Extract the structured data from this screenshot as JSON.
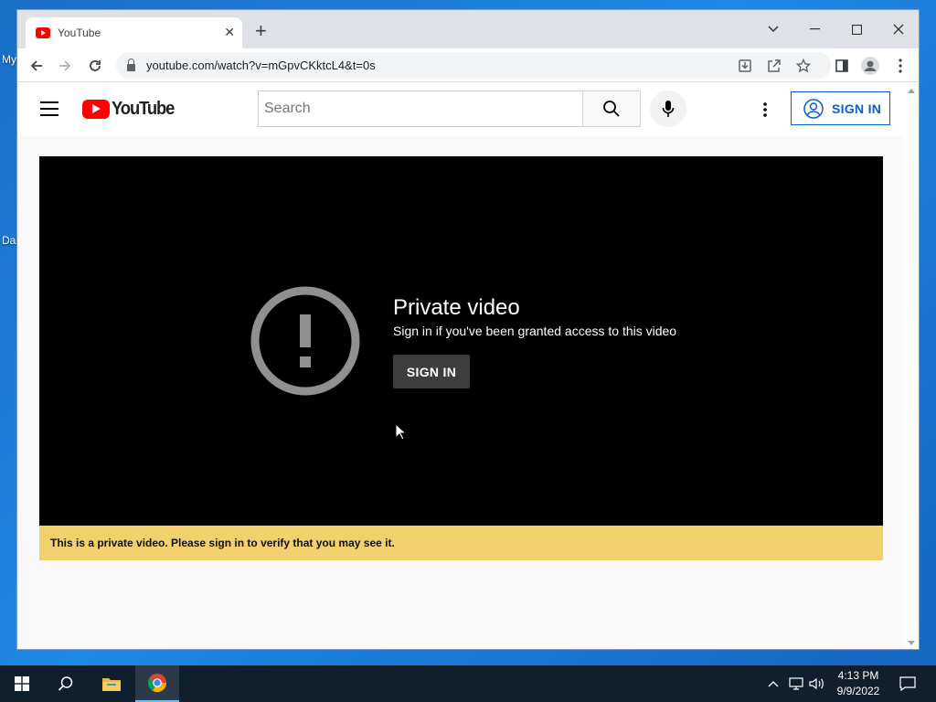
{
  "desktop": {
    "label_1": "My",
    "label_2": "Da"
  },
  "browser": {
    "tab": {
      "title": "YouTube",
      "close": "✕"
    },
    "new_tab": "+",
    "url": "youtube.com/watch?v=mGpvCKktcL4&t=0s",
    "icons": {
      "back": "arrow-left-icon",
      "forward": "arrow-right-icon",
      "reload": "reload-icon",
      "install": "install-icon",
      "share": "share-icon",
      "bookmark": "star-icon",
      "side_panel": "side-panel-icon",
      "profile": "profile-icon",
      "menu": "more-vertical-icon"
    }
  },
  "youtube": {
    "logo_text": "YouTube",
    "search_placeholder": "Search",
    "sign_in_label": "SIGN IN",
    "player": {
      "title": "Private video",
      "subtitle": "Sign in if you've been granted access to this video",
      "sign_in_label": "SIGN IN"
    },
    "warning": "This is a private video. Please sign in to verify that you may see it."
  },
  "taskbar": {
    "time": "4:13 PM",
    "date": "9/9/2022"
  },
  "colors": {
    "yt_red": "#ff0000",
    "link_blue": "#065fd4",
    "warning_yellow": "#f2d06b",
    "taskbar": "#0f1f2d"
  }
}
